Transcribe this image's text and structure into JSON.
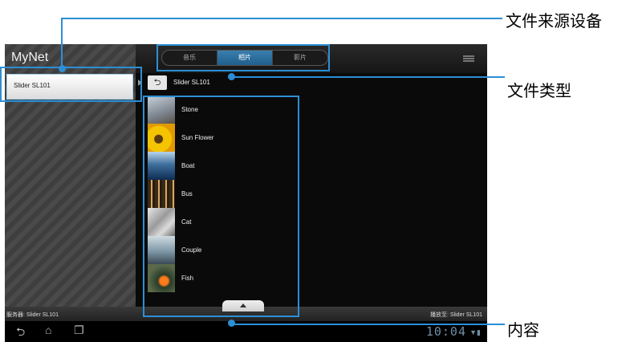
{
  "app": {
    "title": "MyNet"
  },
  "sidebar": {
    "items": [
      {
        "label": "Slider SL101"
      }
    ]
  },
  "tabs": [
    {
      "label": "音乐",
      "active": false
    },
    {
      "label": "相片",
      "active": true
    },
    {
      "label": "影片",
      "active": false
    }
  ],
  "source": {
    "label": "Slider SL101"
  },
  "files": [
    {
      "name": "Stone"
    },
    {
      "name": "Sun Flower"
    },
    {
      "name": "Boat"
    },
    {
      "name": "Bus"
    },
    {
      "name": "Cat"
    },
    {
      "name": "Couple"
    },
    {
      "name": "Fish"
    }
  ],
  "bottom": {
    "server": "服务器: Slider SL101",
    "play_to": "播放至: Slider SL101"
  },
  "statusbar": {
    "time": "10:04"
  },
  "annotations": {
    "source_device": "文件来源设备",
    "file_type": "文件类型",
    "content": "内容"
  },
  "colors": {
    "highlight": "#2c8fd6",
    "active_tab": "#2a6f9e"
  }
}
